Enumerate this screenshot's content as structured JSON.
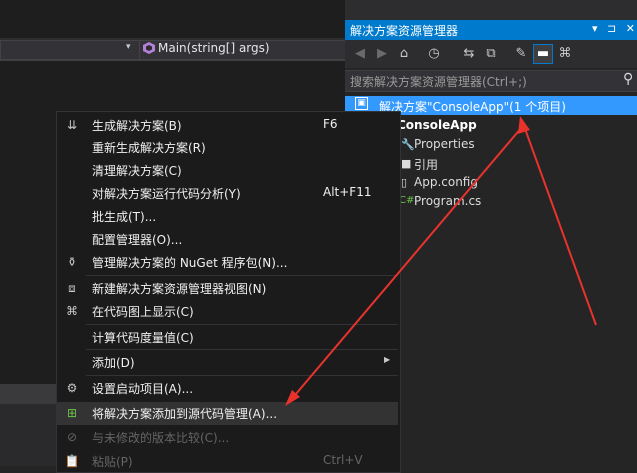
{
  "editor": {
    "method_dropdown": "Main(string[] args)"
  },
  "solution_explorer": {
    "title": "解决方案资源管理器",
    "title_buttons": "▾ ⊐ ✕",
    "search_placeholder": "搜索解决方案资源管理器(Ctrl+;)",
    "toolbar_icons": [
      "back-icon",
      "forward-icon",
      "home-icon",
      "history-icon",
      "sync-icon",
      "collapse-all-icon",
      "properties-icon",
      "preview-icon",
      "class-view-icon"
    ],
    "tree": {
      "solution": "解决方案\"ConsoleApp\"(1 个项目)",
      "project": "ConsoleApp",
      "items": [
        "Properties",
        "引用",
        "App.config",
        "Program.cs"
      ]
    }
  },
  "context_menu": {
    "items": [
      {
        "label": "生成解决方案(B)",
        "shortcut": "F6",
        "icon": "build-icon"
      },
      {
        "label": "重新生成解决方案(R)",
        "shortcut": "",
        "icon": ""
      },
      {
        "label": "清理解决方案(C)",
        "shortcut": "",
        "icon": ""
      },
      {
        "label": "对解决方案运行代码分析(Y)",
        "shortcut": "Alt+F11",
        "icon": ""
      },
      {
        "label": "批生成(T)...",
        "shortcut": "",
        "icon": ""
      },
      {
        "label": "配置管理器(O)...",
        "shortcut": "",
        "icon": ""
      },
      {
        "label": "管理解决方案的 NuGet 程序包(N)...",
        "shortcut": "",
        "icon": "nuget-icon"
      },
      {
        "label": "新建解决方案资源管理器视图(N)",
        "shortcut": "",
        "icon": "new-view-icon"
      },
      {
        "label": "在代码图上显示(C)",
        "shortcut": "",
        "icon": "code-map-icon"
      },
      {
        "label": "计算代码度量值(C)",
        "shortcut": "",
        "icon": ""
      },
      {
        "label": "添加(D)",
        "shortcut": "",
        "icon": ""
      },
      {
        "label": "设置启动项目(A)...",
        "shortcut": "",
        "icon": "gear-icon"
      },
      {
        "label": "将解决方案添加到源代码管理(A)...",
        "shortcut": "",
        "icon": "add-source-control-icon"
      },
      {
        "label": "与未修改的版本比较(C)...",
        "shortcut": "",
        "icon": "compare-icon"
      },
      {
        "label": "粘贴(P)",
        "shortcut": "Ctrl+V",
        "icon": "paste-icon"
      }
    ]
  },
  "colors": {
    "accent": "#007acc",
    "selection": "#3399ff",
    "annotation_arrow": "#e8332c"
  }
}
